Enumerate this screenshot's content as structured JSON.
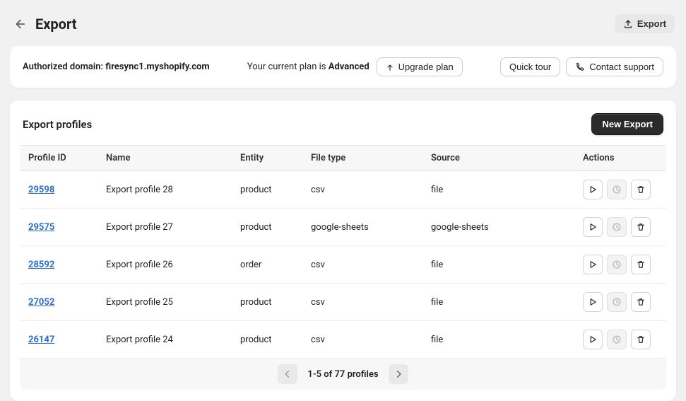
{
  "header": {
    "title": "Export",
    "export_label": "Export"
  },
  "info": {
    "domain_prefix": "Authorized domain: ",
    "domain": "firesync1.myshopify.com",
    "plan_prefix": "Your current plan is ",
    "plan": "Advanced",
    "upgrade_label": "Upgrade plan",
    "quick_tour_label": "Quick tour",
    "contact_label": "Contact support"
  },
  "card": {
    "title": "Export profiles",
    "new_export_label": "New Export"
  },
  "table": {
    "columns": {
      "profile_id": "Profile ID",
      "name": "Name",
      "entity": "Entity",
      "file_type": "File type",
      "source": "Source",
      "actions": "Actions"
    },
    "rows": [
      {
        "id": "29598",
        "name": "Export profile 28",
        "entity": "product",
        "file_type": "csv",
        "source": "file"
      },
      {
        "id": "29575",
        "name": "Export profile 27",
        "entity": "product",
        "file_type": "google-sheets",
        "source": "google-sheets"
      },
      {
        "id": "28592",
        "name": "Export profile 26",
        "entity": "order",
        "file_type": "csv",
        "source": "file"
      },
      {
        "id": "27052",
        "name": "Export profile 25",
        "entity": "product",
        "file_type": "csv",
        "source": "file"
      },
      {
        "id": "26147",
        "name": "Export profile 24",
        "entity": "product",
        "file_type": "csv",
        "source": "file"
      }
    ]
  },
  "pagination": {
    "text": "1-5 of 77 profiles"
  }
}
